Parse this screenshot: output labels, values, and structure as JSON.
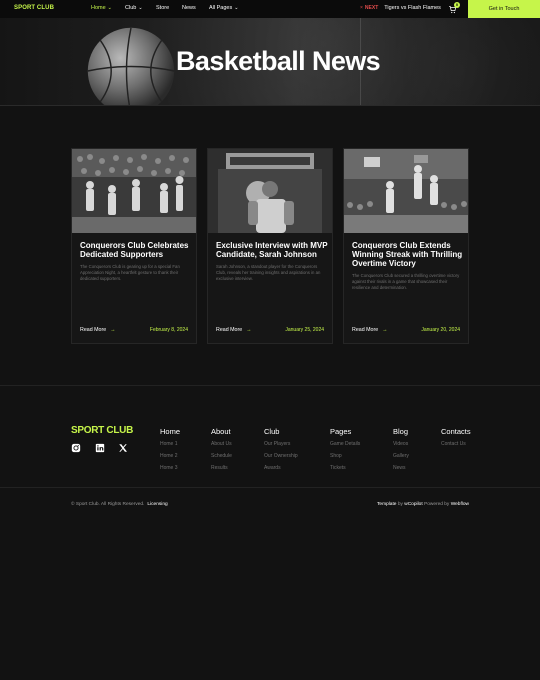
{
  "nav": {
    "logo": "SPORT CLUB",
    "links": [
      {
        "label": "Home",
        "dropdown": true,
        "active": true
      },
      {
        "label": "Club",
        "dropdown": true
      },
      {
        "label": "Store",
        "dropdown": false
      },
      {
        "label": "News",
        "dropdown": false
      },
      {
        "label": "All Pages",
        "dropdown": true
      }
    ],
    "next_label": "NEXT",
    "next_match": "Tigers vs Flash Flames",
    "cart_count": "0",
    "cta": "Get in Touch"
  },
  "hero": {
    "title": "Basketball News"
  },
  "cards": [
    {
      "title": "Conquerors Club Celebrates Dedicated Supporters",
      "excerpt": "The Conquerors Club is gearing up for a special Fan Appreciation Night, a heartfelt gesture to thank their dedicated supporters.",
      "read_more": "Read More",
      "date": "February 8, 2024"
    },
    {
      "title": "Exclusive Interview with MVP Candidate, Sarah Johnson",
      "excerpt": "Sarah Johnson, a standout player for the Conquerors Club, reveals her training insights and aspirations in an exclusive interview.",
      "read_more": "Read More",
      "date": "January 25, 2024"
    },
    {
      "title": "Conquerors Club Extends Winning Streak with Thrilling Overtime Victory",
      "excerpt": "The Conquerors Club secured a thrilling overtime victory against their rivals in a game that showcased their resilience and determination.",
      "read_more": "Read More",
      "date": "January 20, 2024"
    }
  ],
  "footer": {
    "logo": "SPORT CLUB",
    "columns": [
      {
        "title": "Home",
        "links": [
          "Home 1",
          "Home 2",
          "Home 3"
        ]
      },
      {
        "title": "About",
        "links": [
          "About Us",
          "Schedule",
          "Results"
        ]
      },
      {
        "title": "Club",
        "links": [
          "Our Players",
          "Our Ownership",
          "Awards"
        ]
      },
      {
        "title": "Pages",
        "links": [
          "Game Details",
          "Shop",
          "Tickets"
        ]
      },
      {
        "title": "Blog",
        "links": [
          "Videos",
          "Gallery",
          "News"
        ]
      },
      {
        "title": "Contacts",
        "links": [
          "Contact Us"
        ]
      }
    ],
    "copyright": "© Sport Club. All Rights Reserved.",
    "licensing": "Licensing",
    "credit_template": "Template",
    "credit_by": "by",
    "credit_author": "wCopilot",
    "credit_powered": "Powered by",
    "credit_platform": "Webflow"
  },
  "colors": {
    "accent": "#c6f54a",
    "background": "#121212",
    "next_red": "#e24b4b"
  }
}
